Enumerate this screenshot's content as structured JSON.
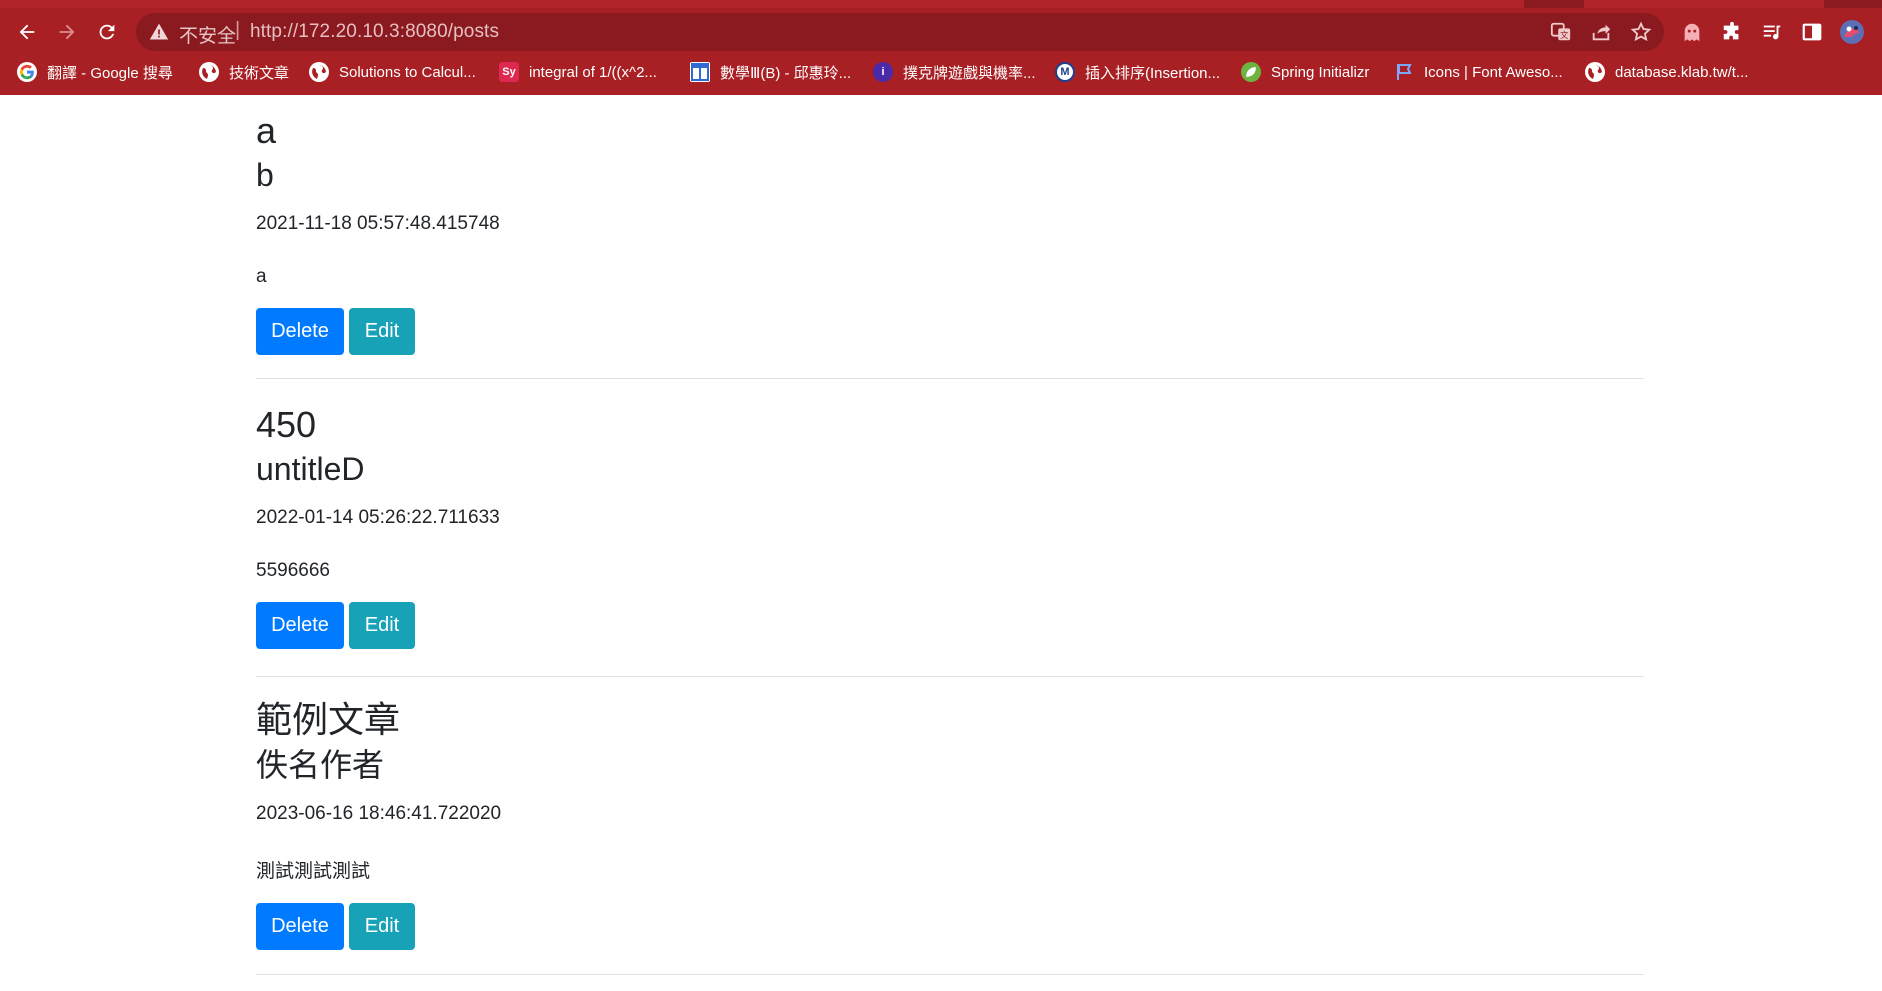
{
  "browser": {
    "insecure_label": "不安全",
    "url_host": "http://172.20.10.3",
    "url_rest": ":8080/posts",
    "accent_color": "#a81f24"
  },
  "bookmarks": [
    {
      "label": "翻譯 - Google 搜尋",
      "icon": "google-icon"
    },
    {
      "label": "技術文章",
      "icon": "globe-icon"
    },
    {
      "label": "Solutions to Calcul...",
      "icon": "globe-icon"
    },
    {
      "label": "integral of 1/((x^2...",
      "icon": "symbolab-icon",
      "icon_text": "Sy"
    },
    {
      "label": "數學Ⅲ(B) - 邱惠玲...",
      "icon": "calendar-icon"
    },
    {
      "label": "撲克牌遊戲與機率...",
      "icon": "info-icon",
      "icon_text": "i"
    },
    {
      "label": "插入排序(Insertion...",
      "icon": "m-icon",
      "icon_text": "M"
    },
    {
      "label": "Spring Initializr",
      "icon": "spring-leaf-icon"
    },
    {
      "label": "Icons | Font Aweso...",
      "icon": "flag-icon"
    },
    {
      "label": "database.klab.tw/t...",
      "icon": "globe-icon"
    }
  ],
  "posts": [
    {
      "title": "a",
      "author": "b",
      "time": "2021-11-18 05:57:48.415748",
      "body": "a",
      "delete_label": "Delete",
      "edit_label": "Edit"
    },
    {
      "title": "450",
      "author": "untitleD",
      "time": "2022-01-14 05:26:22.711633",
      "body": "5596666",
      "delete_label": "Delete",
      "edit_label": "Edit"
    },
    {
      "title": "範例文章",
      "author": "佚名作者",
      "time": "2023-06-16 18:46:41.722020",
      "body": "測試測試測試",
      "delete_label": "Delete",
      "edit_label": "Edit"
    }
  ]
}
